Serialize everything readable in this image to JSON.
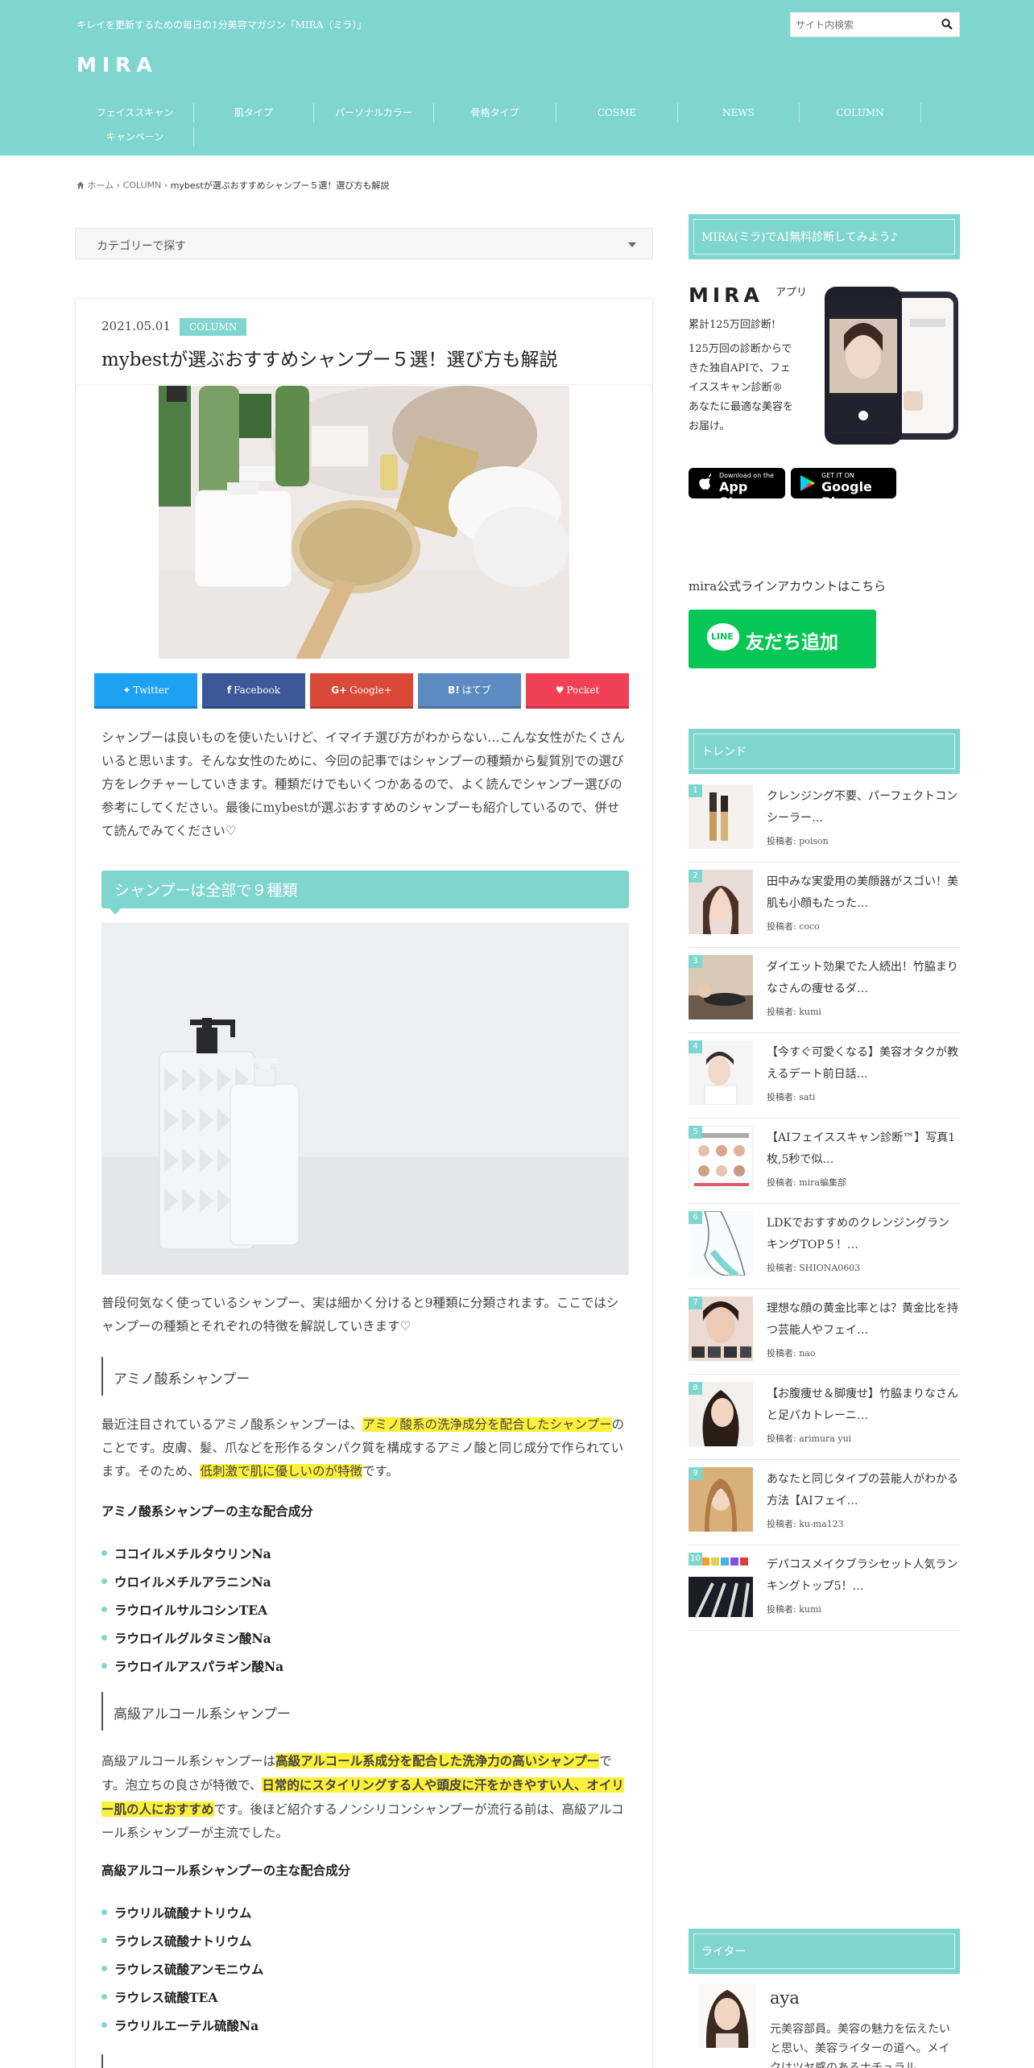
{
  "header": {
    "tagline": "キレイを更新するための毎日の1分美容マガジン「MIRA（ミラ）」",
    "logo": "MIRA",
    "search_placeholder": "サイト内検索",
    "nav": [
      "フェイススキャン",
      "肌タイプ",
      "パーソナルカラー",
      "骨格タイプ",
      "COSME",
      "NEWS",
      "COLUMN",
      "キャンペーン"
    ]
  },
  "breadcrumb": {
    "home": "ホーム",
    "category": "COLUMN",
    "current": "mybestが選ぶおすすめシャンプー５選！選び方も解説"
  },
  "category_select": {
    "label": "カテゴリーで探す"
  },
  "article": {
    "date": "2021.05.01",
    "category": "COLUMN",
    "title": "mybestが選ぶおすすめシャンプー５選！選び方も解説",
    "share": [
      {
        "label": "Twitter",
        "icon": "twitter-icon",
        "color": "#1da1f2"
      },
      {
        "label": "Facebook",
        "icon": "facebook-icon",
        "color": "#3b5998"
      },
      {
        "label": "Google+",
        "icon": "googleplus-icon",
        "color": "#db4a39"
      },
      {
        "label": "はてブ",
        "icon": "hatena-icon",
        "color": "#5d8ac1"
      },
      {
        "label": "Pocket",
        "icon": "pocket-icon",
        "color": "#ef4056"
      }
    ],
    "intro": "シャンプーは良いものを使いたいけど、イマイチ選び方がわからない…こんな女性がたくさんいると思います。そんな女性のために、今回の記事ではシャンプーの種類から髪質別での選び方をレクチャーしていきます。種類だけでもいくつかあるので、よく読んでシャンプー選びの参考にしてください。最後にmybestが選ぶおすすめのシャンプーも紹介しているので、併せて読んでみてください♡",
    "h2": "シャンプーは全部で９種類",
    "p2": "普段何気なく使っているシャンプー、実は細かく分けると9種類に分類されます。ここではシャンプーの種類とそれぞれの特徴を解説していきます♡",
    "sec1": {
      "heading": "アミノ酸系シャンプー",
      "p_a": "最近注目されているアミノ酸系シャンプーは、",
      "p_hl1": "アミノ酸系の洗浄成分を配合したシャンプー",
      "p_b": "のことです。皮膚、髪、爪などを形作るタンパク質を構成するアミノ酸と同じ成分で作られています。そのため、",
      "p_hl2": "低刺激で肌に優しいのが特徴",
      "p_c": "です。",
      "ingredients_title": "アミノ酸系シャンプーの主な配合成分",
      "ingredients": [
        "ココイルメチルタウリンNa",
        "ウロイルメチルアラニンNa",
        "ラウロイルサルコシンTEA",
        "ラウロイルグルタミン酸Na",
        "ラウロイルアスパラギン酸Na"
      ]
    },
    "sec2": {
      "heading": "高級アルコール系シャンプー",
      "p_a": "高級アルコール系シャンプーは",
      "p_hl1": "高級アルコール系成分を配合した洗浄力の高いシャンプー",
      "p_b": "です。泡立ちの良さが特徴で、",
      "p_hl2": "日常的にスタイリングする人や頭皮に汗をかきやすい人、オイリー肌の人におすすめ",
      "p_c": "です。後ほど紹介するノンシリコンシャンプーが流行る前は、高級アルコール系シャンプーが主流でした。",
      "ingredients_title": "高級アルコール系シャンプーの主な配合成分",
      "ingredients": [
        "ラウリル硫酸ナトリウム",
        "ラウレス硫酸ナトリウム",
        "ラウレス硫酸アンモニウム",
        "ラウレス硫酸TEA",
        "ラウリルエーテル硫酸Na"
      ]
    }
  },
  "sidebar": {
    "ai_head": "MIRA(ミラ)でAI無料診断してみよう♪",
    "app_logo": "MIRA",
    "app_logo_sub": "アプリ",
    "app_text": [
      "累計125万回診断!",
      "125万回の診断からできた独自APIで、フェイススキャン診断®",
      "あなたに最適な美容をお届け。"
    ],
    "app_store": {
      "small": "Download on the",
      "big": "App Store"
    },
    "google_play": {
      "small": "GET IT ON",
      "big": "Google Play"
    },
    "line_label": "mira公式ラインアカウントはこちら",
    "line_button": "友だち追加",
    "line_logo": "LINE",
    "trend_head": "トレンド",
    "trend": [
      {
        "rank": "1",
        "title": "クレンジング不要、パーフェクトコンシーラー…",
        "author": "投稿者: poison"
      },
      {
        "rank": "2",
        "title": "田中みな実愛用の美顔器がスゴい！美肌も小顔もたった…",
        "author": "投稿者: coco"
      },
      {
        "rank": "3",
        "title": "ダイエット効果でた人続出！竹脇まりなさんの痩せるダ…",
        "author": "投稿者: kumi"
      },
      {
        "rank": "4",
        "title": "【今すぐ可愛くなる】美容オタクが教えるデート前日話…",
        "author": "投稿者: sati"
      },
      {
        "rank": "5",
        "title": "【AIフェイススキャン診断™】写真1枚,5秒で似…",
        "author": "投稿者: mira編集部"
      },
      {
        "rank": "6",
        "title": "LDKでおすすめのクレンジングランキングTOP５！…",
        "author": "投稿者: SHIONA0603"
      },
      {
        "rank": "7",
        "title": "理想な顔の黄金比率とは？黄金比を持つ芸能人やフェイ…",
        "author": "投稿者: nao"
      },
      {
        "rank": "8",
        "title": "【お腹痩せ＆脚痩せ】竹脇まりなさんと足パカトレーニ…",
        "author": "投稿者: arimura yui"
      },
      {
        "rank": "9",
        "title": "あなたと同じタイプの芸能人がわかる方法【AIフェイ…",
        "author": "投稿者: ku-ma123"
      },
      {
        "rank": "10",
        "title": "デパコスメイクブラシセット人気ランキングトップ5！…",
        "author": "投稿者: kumi"
      }
    ],
    "writer_head": "ライター",
    "writer_name": "aya",
    "writer_bio": "元美容部員。美容の魅力を伝えたいと思い、美容ライターの道へ。メイクはツヤ感のあるナチュラル"
  },
  "colors": {
    "accent": "#7fd6cf",
    "highlight": "#fdf03b",
    "line_green": "#06c755"
  }
}
